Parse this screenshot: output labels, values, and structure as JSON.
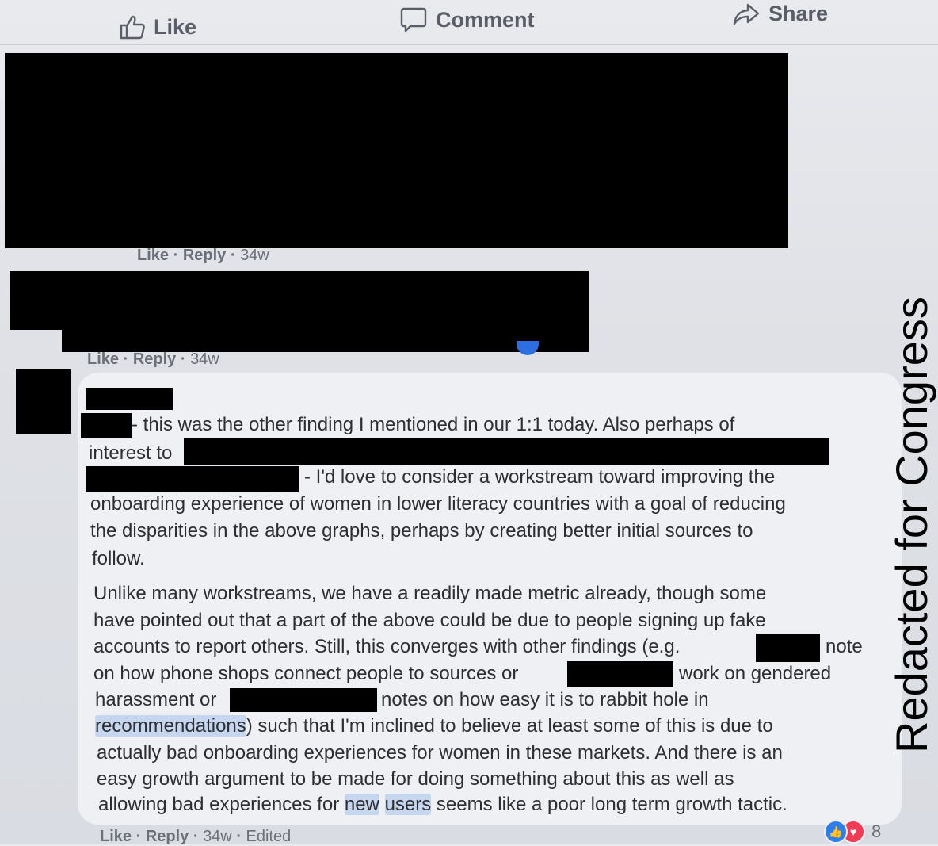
{
  "action_bar": {
    "like_label": "Like",
    "comment_label": "Comment",
    "share_label": "Share"
  },
  "comment1": {
    "like_label": "Like",
    "reply_label": "Reply",
    "time": "34w"
  },
  "comment2": {
    "like_label": "Like",
    "reply_label": "Reply",
    "time": "34w"
  },
  "comment3": {
    "paragraph1": {
      "line1": "- this was the other finding I mentioned in our 1:1 today. Also perhaps of",
      "line2": "interest to",
      "line3": "- I'd love to consider a workstream toward improving the",
      "line4": "onboarding experience of women in lower literacy countries with a goal of reducing",
      "line5": "the disparities in the above graphs, perhaps by creating better initial sources to",
      "line6": "follow."
    },
    "paragraph2": {
      "line1": "Unlike many workstreams, we have a readily made metric already, though some",
      "line2": "have pointed out that a part of the above could be due to people signing up fake",
      "line3a": "accounts to report others. Still, this converges with other findings (e.g.",
      "line3b": "note",
      "line4a": "on how phone shops connect people to sources or",
      "line4b": "work on gendered",
      "line5a": "harassment or",
      "line5b": "notes on how easy it is to rabbit hole in",
      "line6_link": "recommendations",
      "line6_rest": ") such that I'm inclined to believe at least some of this is due to",
      "line7": "actually bad onboarding experiences for women in these markets. And there is an",
      "line8": "easy growth argument to be made for doing something about this as well as",
      "line9a": "allowing bad experiences for",
      "line9_link1": "new",
      "line9_link2": "users",
      "line9b": "seems like a poor long term growth tactic."
    },
    "meta": {
      "like_label": "Like",
      "reply_label": "Reply",
      "time": "34w",
      "edited": "Edited"
    },
    "reaction_count": "8"
  },
  "watermark": "Redacted for Congress",
  "colors": {
    "redaction": "#000000",
    "link_highlight": "#c6d6ee",
    "like_reaction": "#2d7ff0",
    "love_reaction": "#ef3c54"
  },
  "icons": [
    "thumbs-up-icon",
    "comment-bubble-icon",
    "share-arrow-icon"
  ]
}
